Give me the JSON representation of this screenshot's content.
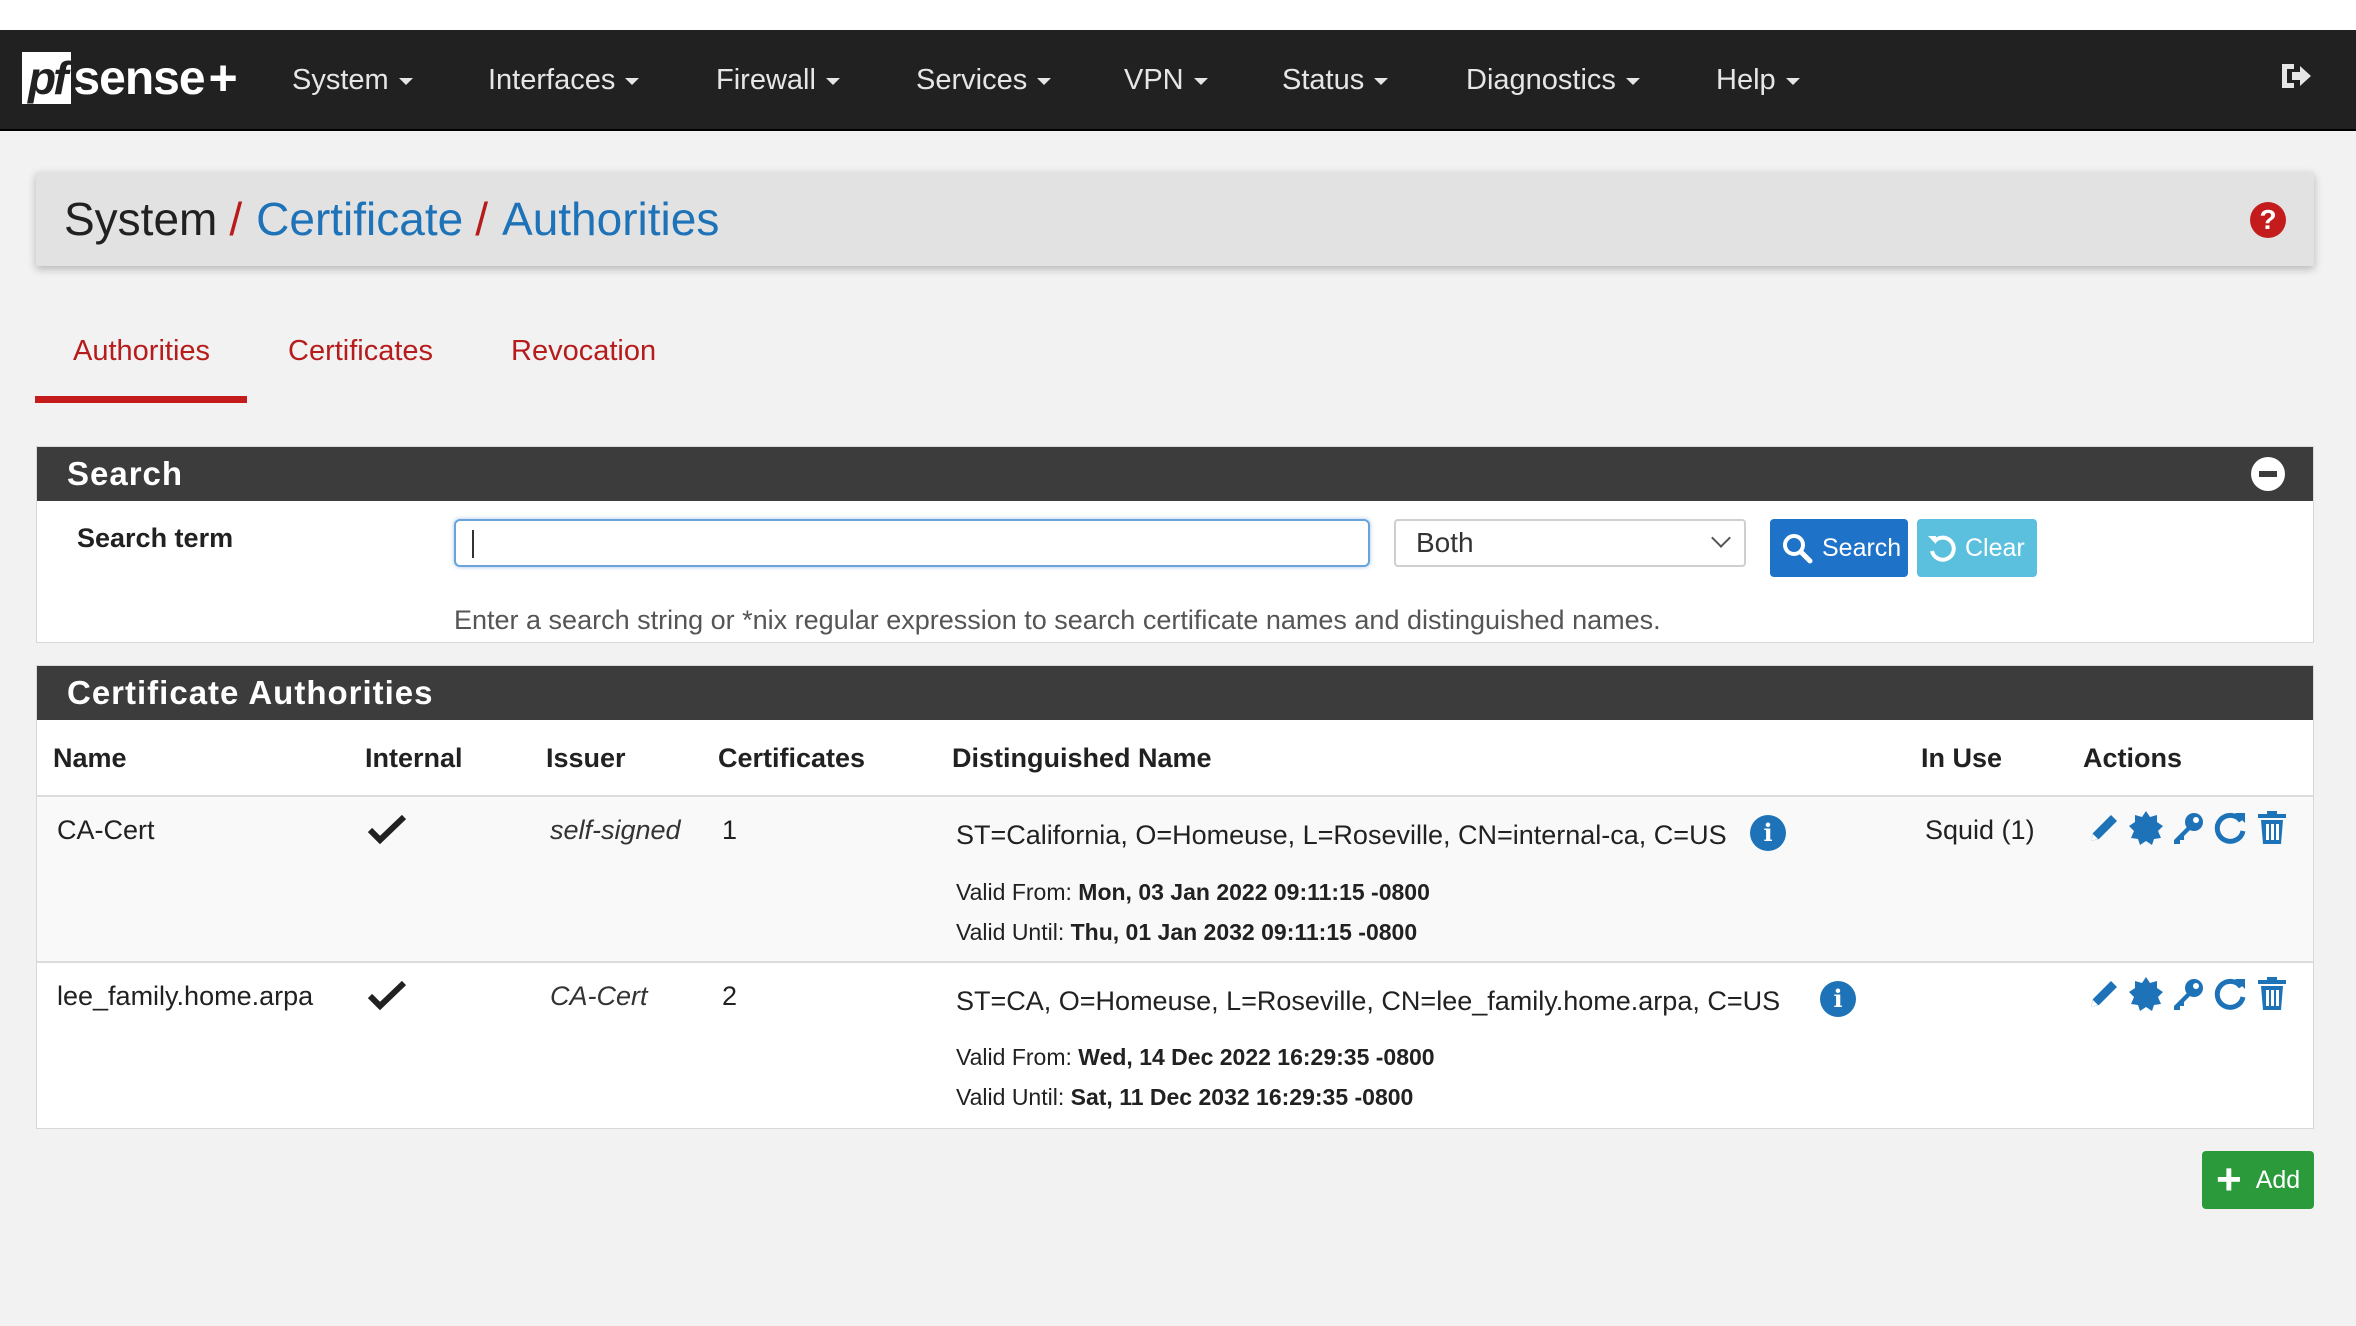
{
  "brand": {
    "pf": "pf",
    "sense": "sense",
    "plus": "+"
  },
  "nav": {
    "items": [
      "System",
      "Interfaces",
      "Firewall",
      "Services",
      "VPN",
      "Status",
      "Diagnostics",
      "Help"
    ],
    "logout_icon": "logout-icon"
  },
  "breadcrumb": {
    "root": "System",
    "sep": "/",
    "level1": "Certificate",
    "level2": "Authorities"
  },
  "tabs": [
    "Authorities",
    "Certificates",
    "Revocation"
  ],
  "active_tab": "Authorities",
  "search": {
    "title": "Search",
    "label": "Search term",
    "input_value": "",
    "scope_selected": "Both",
    "search_button": "Search",
    "clear_button": "Clear",
    "help_text": "Enter a search string or *nix regular expression to search certificate names and distinguished names."
  },
  "ca_table": {
    "title": "Certificate Authorities",
    "headers": [
      "Name",
      "Internal",
      "Issuer",
      "Certificates",
      "Distinguished Name",
      "In Use",
      "Actions"
    ],
    "rows": [
      {
        "name": "CA-Cert",
        "internal": true,
        "issuer": "self-signed",
        "certificates": "1",
        "dn": "ST=California, O=Homeuse, L=Roseville, CN=internal-ca, C=US",
        "valid_from_label": "Valid From:",
        "valid_from": "Mon, 03 Jan 2022 09:11:15 -0800",
        "valid_until_label": "Valid Until:",
        "valid_until": "Thu, 01 Jan 2032 09:11:15 -0800",
        "in_use": "Squid (1)"
      },
      {
        "name": "lee_family.home.arpa",
        "internal": true,
        "issuer": "CA-Cert",
        "certificates": "2",
        "dn": "ST=CA, O=Homeuse, L=Roseville, CN=lee_family.home.arpa, C=US",
        "valid_from_label": "Valid From:",
        "valid_from": "Wed, 14 Dec 2022 16:29:35 -0800",
        "valid_until_label": "Valid Until:",
        "valid_until": "Sat, 11 Dec 2032 16:29:35 -0800",
        "in_use": ""
      }
    ]
  },
  "add_button": "Add",
  "colors": {
    "accent_red": "#c41c1c",
    "link_blue": "#1e73b8",
    "nav_bg": "#212121",
    "add_green": "#2b9a3a"
  }
}
